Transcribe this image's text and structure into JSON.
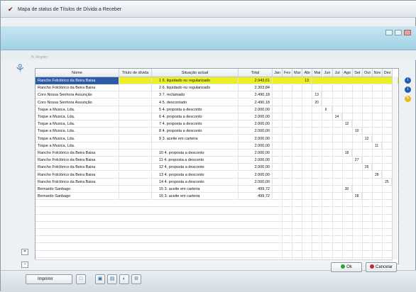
{
  "window": {
    "title": "Mapa de status de Títulos de Dívida a Receber",
    "filter_label": "N. Registo"
  },
  "columns": {
    "name": "Nome",
    "title": "Título de dívida",
    "status": "Situação actual",
    "total": "Total"
  },
  "months": [
    "Jan",
    "Fev",
    "Mar",
    "Abr",
    "Mai",
    "Jun",
    "Jul",
    "Ago",
    "Set",
    "Out",
    "Nov",
    "Dez"
  ],
  "rows": [
    {
      "name": "Rancho Folclórico da Beira Baixa",
      "title": "",
      "status": "1 6. liquidado ou regularizado",
      "total": "2.943,61",
      "week": "13",
      "month": 4
    },
    {
      "name": "Rancho Folclórico da Beira Baixa",
      "title": "",
      "status": "2 6. liquidado ou regularizado",
      "total": "2.303,84",
      "week": "",
      "month": 0
    },
    {
      "name": "Coro Nossa Senhora Assunção",
      "title": "",
      "status": "3 7. reclamado",
      "total": "2.490,18",
      "week": "13",
      "month": 5
    },
    {
      "name": "Coro Nossa Senhora Assunção",
      "title": "",
      "status": "4 5. descontado",
      "total": "2.490,18",
      "week": "20",
      "month": 5
    },
    {
      "name": "Toque a Musica, Lda.",
      "title": "",
      "status": "5 4. proposta a desconto",
      "total": "2.000,00",
      "week": "9",
      "month": 6
    },
    {
      "name": "Toque a Musica, Lda.",
      "title": "",
      "status": "6 4. proposta a desconto",
      "total": "2.000,00",
      "week": "14",
      "month": 7
    },
    {
      "name": "Toque a Musica, Lda.",
      "title": "",
      "status": "7 4. proposta a desconto",
      "total": "2.000,00",
      "week": "12",
      "month": 8
    },
    {
      "name": "Toque a Musica, Lda.",
      "title": "",
      "status": "8 4. proposta a desconto",
      "total": "2.000,00",
      "week": "10",
      "month": 9
    },
    {
      "name": "Toque a Musica, Lda.",
      "title": "",
      "status": "9 3. aceite em carteira",
      "total": "2.000,00",
      "week": "12",
      "month": 10
    },
    {
      "name": "Toque a Musica, Lda.",
      "title": "",
      "status": "",
      "total": "2.000,00",
      "week": "11",
      "month": 11
    },
    {
      "name": "Rancho Folclórico da Beira Baixa",
      "title": "",
      "status": "10 4. proposta a desconto",
      "total": "2.000,00",
      "week": "18",
      "month": 8
    },
    {
      "name": "Rancho Folclórico da Beira Baixa",
      "title": "",
      "status": "11 4. proposta a desconto",
      "total": "2.000,00",
      "week": "27",
      "month": 9
    },
    {
      "name": "Rancho Folclórico da Beira Baixa",
      "title": "",
      "status": "12 4. proposta a desconto",
      "total": "2.000,00",
      "week": "26",
      "month": 10
    },
    {
      "name": "Rancho Folclórico da Beira Baixa",
      "title": "",
      "status": "13 4. proposta a desconto",
      "total": "2.000,00",
      "week": "28",
      "month": 11
    },
    {
      "name": "Rancho Folclórico da Beira Baixa",
      "title": "",
      "status": "14 4. proposta a desconto",
      "total": "2.000,00",
      "week": "25",
      "month": 12
    },
    {
      "name": "Bernardo Sanbago",
      "title": "",
      "status": "15 3. aceite em carteira",
      "total": "499,72",
      "week": "30",
      "month": 8
    },
    {
      "name": "Bernardo Sanbago",
      "title": "",
      "status": "16 3. aceite em carteira",
      "total": "499,72",
      "week": "28",
      "month": 9
    }
  ],
  "buttons": {
    "print": "Imprimir",
    "ok": "Ok",
    "cancel": "Cancelar"
  },
  "colors": {
    "highlight": "#ecf020",
    "selection": "#2d5ba8",
    "ribbon": "#9fd2e4",
    "ok": "#2e9d3a",
    "cancel": "#c8252d"
  }
}
